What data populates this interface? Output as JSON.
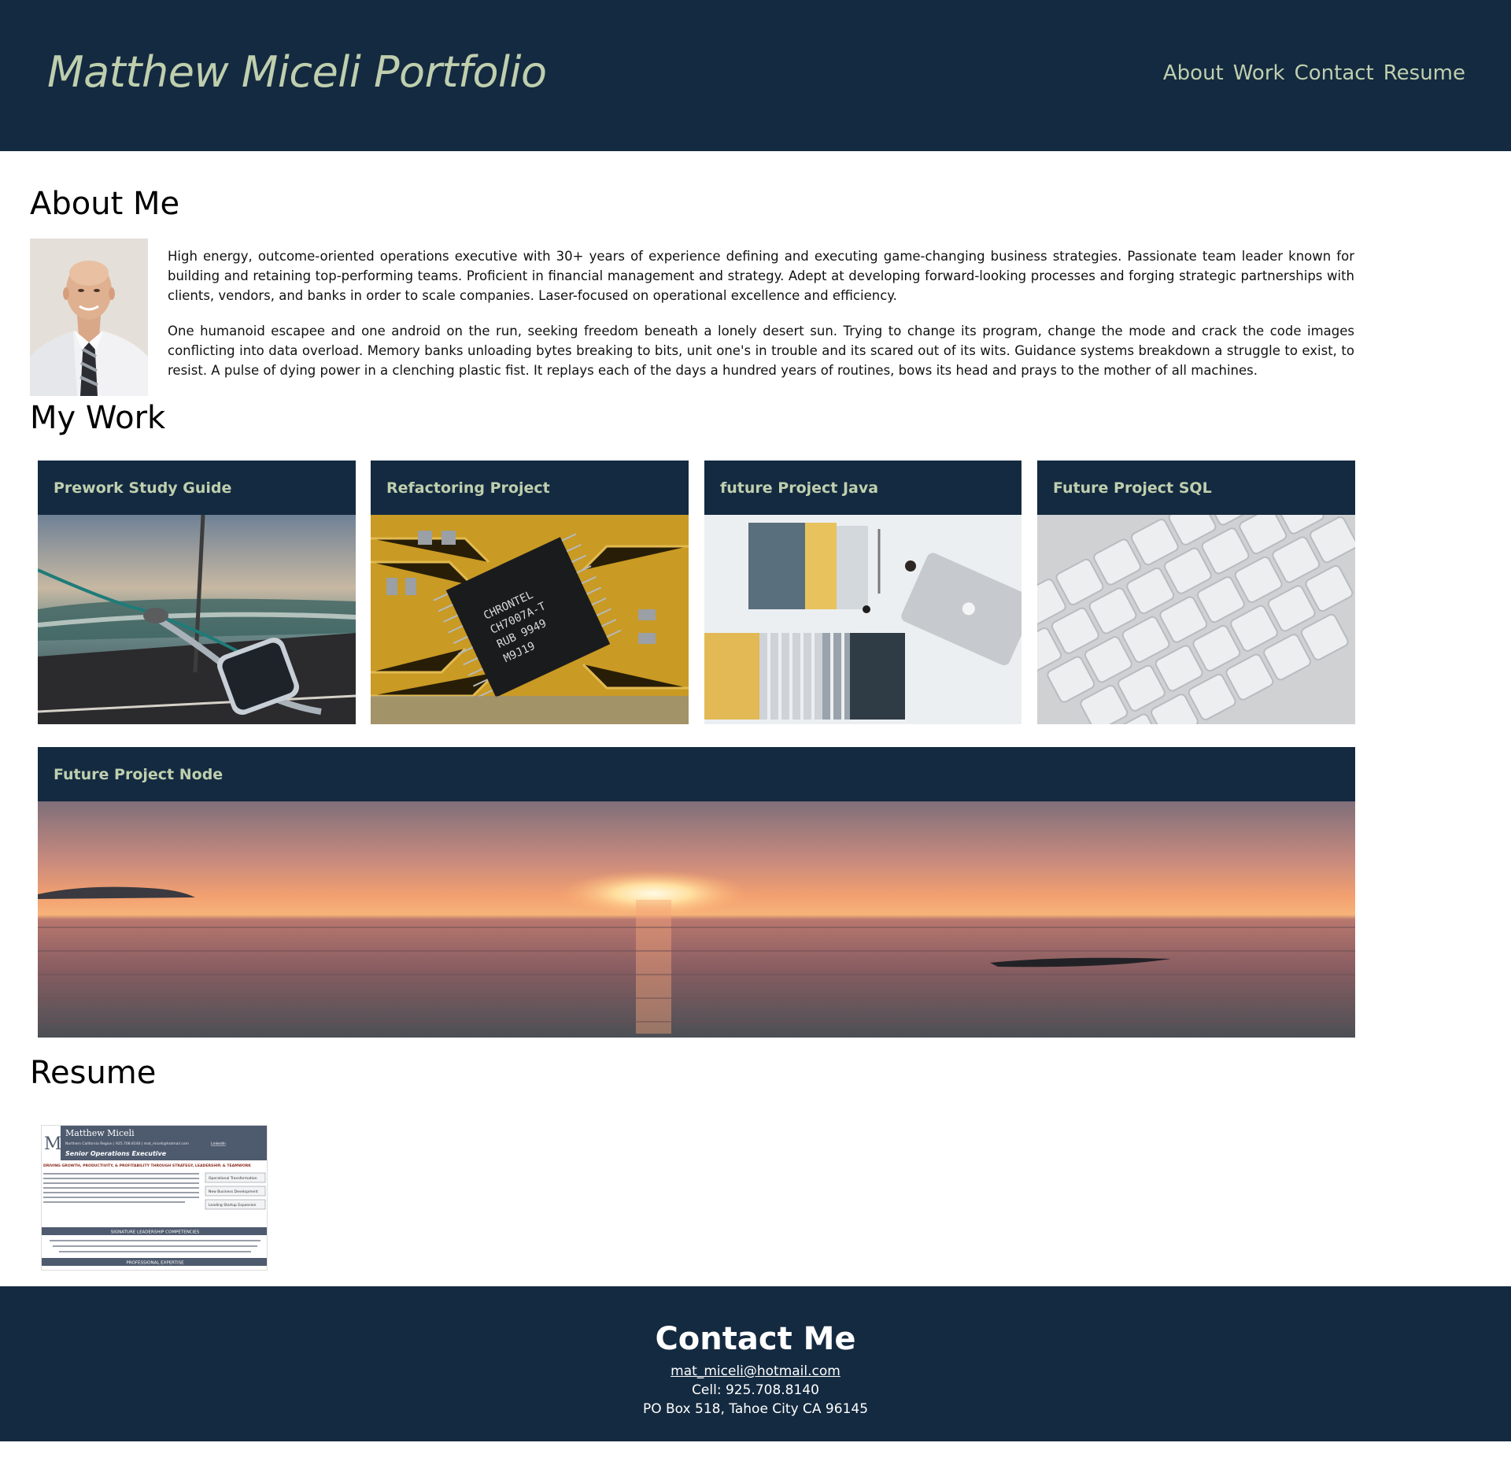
{
  "header": {
    "title": "Matthew Miceli Portfolio",
    "nav": [
      "About",
      "Work",
      "Contact",
      "Resume"
    ]
  },
  "about": {
    "heading": "About Me",
    "paragraphs": [
      "High energy, outcome-oriented operations executive with 30+ years of experience defining and executing game-changing business strategies. Passionate team leader known for building and retaining top-performing teams. Proficient in financial management and strategy. Adept at developing forward-looking processes and forging strategic partnerships with clients, vendors, and banks in order to scale companies. Laser-focused on operational excellence and efficiency.",
      "One humanoid escapee and one android on the run, seeking freedom beneath a lonely desert sun. Trying to change its program, change the mode and crack the code images conflicting into data overload. Memory banks unloading bytes breaking to bits, unit one's in trouble and its scared out of its wits. Guidance systems breakdown a struggle to exist, to resist. A pulse of dying power in a clenching plastic fist. It replays each of the days a hundred years of routines, bows its head and prays to the mother of all machines."
    ]
  },
  "work": {
    "heading": "My Work",
    "projects": [
      "Prework Study Guide",
      "Refactoring Project",
      "future Project Java",
      "Future Project SQL",
      "Future Project Node"
    ]
  },
  "resume": {
    "heading": "Resume",
    "thumb": {
      "name": "Matthew Miceli",
      "contact_line": "Northern California Region | 925.708.8140 | mat_miceli@hotmail.com",
      "link": "LinkedIn",
      "role": "Senior Operations Executive",
      "tagline": "DRIVING GROWTH, PRODUCTIVITY, & PROFITABILITY THROUGH STRATEGY, LEADERSHIP, & TEAMWORK",
      "side_items": [
        "Operational Transformation",
        "New Business Development",
        "Leading Startup Expansion"
      ],
      "competencies": "SIGNATURE LEADERSHIP COMPETENCIES",
      "expertise": "PROFESSIONAL EXPERTISE"
    }
  },
  "contact": {
    "heading": "Contact Me",
    "email": "mat_miceli@hotmail.com",
    "cell": "Cell: 925.708.8140",
    "address": "PO Box 518, Tahoe City CA 96145"
  },
  "colors": {
    "navy": "#142a40",
    "sage": "#bfcfae"
  }
}
